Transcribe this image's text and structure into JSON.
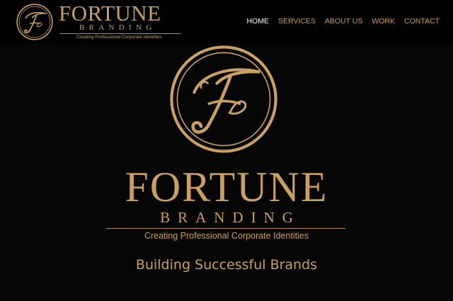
{
  "header": {
    "brand_name": "FORTUNE",
    "brand_sub": "BRANDING",
    "tagline": "Creating Professional Corporate Identities",
    "logo_icon": "fortune-f-monogram-icon"
  },
  "nav": {
    "items": [
      {
        "label": "HOME",
        "active": true
      },
      {
        "label": "SERVICES",
        "active": false
      },
      {
        "label": "ABOUT US",
        "active": false
      },
      {
        "label": "WORK",
        "active": false
      },
      {
        "label": "CONTACT",
        "active": false
      }
    ]
  },
  "hero": {
    "brand_name": "FORTUNE",
    "brand_sub": "BRANDING",
    "tagline": "Creating Professional Corporate Identities",
    "slogan": "Building Successful Brands",
    "logo_icon": "fortune-f-monogram-icon"
  },
  "colors": {
    "background": "#060606",
    "gold": "#c9a062",
    "nav_active": "#ffffff"
  }
}
